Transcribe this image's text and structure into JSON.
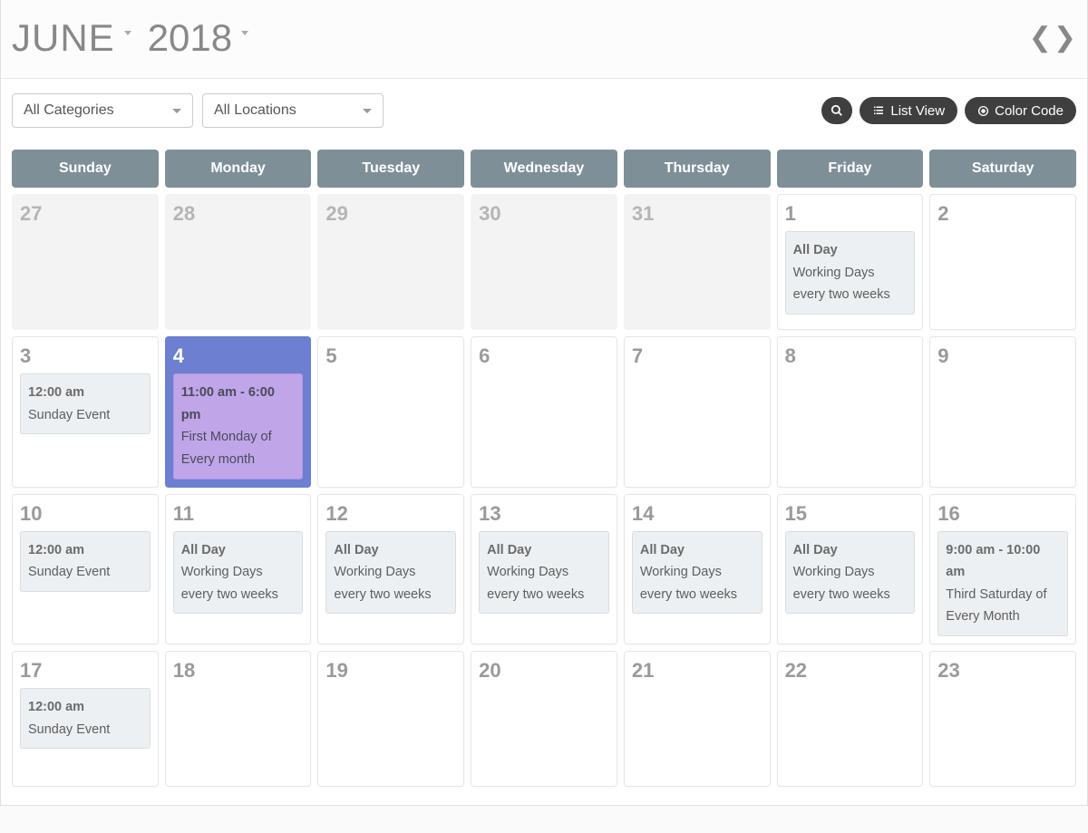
{
  "header": {
    "month": "JUNE",
    "year": "2018"
  },
  "filters": {
    "categories": "All Categories",
    "locations": "All Locations"
  },
  "toolbar": {
    "list_view": "List View",
    "color_code": "Color Code"
  },
  "weekdays": [
    "Sunday",
    "Monday",
    "Tuesday",
    "Wednesday",
    "Thursday",
    "Friday",
    "Saturday"
  ],
  "weeks": [
    [
      {
        "num": "27",
        "otherMonth": true
      },
      {
        "num": "28",
        "otherMonth": true
      },
      {
        "num": "29",
        "otherMonth": true
      },
      {
        "num": "30",
        "otherMonth": true
      },
      {
        "num": "31",
        "otherMonth": true
      },
      {
        "num": "1",
        "events": [
          {
            "time": "All Day",
            "title": "Working Days every two weeks"
          }
        ]
      },
      {
        "num": "2"
      }
    ],
    [
      {
        "num": "3",
        "events": [
          {
            "time": "12:00 am",
            "title": "Sunday Event"
          }
        ]
      },
      {
        "num": "4",
        "highlighted": true,
        "events": [
          {
            "time": "11:00 am - 6:00 pm",
            "title": "First Monday of Every month",
            "style": "purple"
          }
        ]
      },
      {
        "num": "5"
      },
      {
        "num": "6"
      },
      {
        "num": "7"
      },
      {
        "num": "8"
      },
      {
        "num": "9"
      }
    ],
    [
      {
        "num": "10",
        "events": [
          {
            "time": "12:00 am",
            "title": "Sunday Event"
          }
        ]
      },
      {
        "num": "11",
        "events": [
          {
            "time": "All Day",
            "title": "Working Days every two weeks"
          }
        ]
      },
      {
        "num": "12",
        "events": [
          {
            "time": "All Day",
            "title": "Working Days every two weeks"
          }
        ]
      },
      {
        "num": "13",
        "events": [
          {
            "time": "All Day",
            "title": "Working Days every two weeks"
          }
        ]
      },
      {
        "num": "14",
        "events": [
          {
            "time": "All Day",
            "title": "Working Days every two weeks"
          }
        ]
      },
      {
        "num": "15",
        "events": [
          {
            "time": "All Day",
            "title": "Working Days every two weeks"
          }
        ]
      },
      {
        "num": "16",
        "events": [
          {
            "time": "9:00 am - 10:00 am",
            "title": "Third Saturday of Every Month"
          }
        ]
      }
    ],
    [
      {
        "num": "17",
        "events": [
          {
            "time": "12:00 am",
            "title": "Sunday Event"
          }
        ]
      },
      {
        "num": "18"
      },
      {
        "num": "19"
      },
      {
        "num": "20"
      },
      {
        "num": "21"
      },
      {
        "num": "22"
      },
      {
        "num": "23"
      }
    ]
  ]
}
